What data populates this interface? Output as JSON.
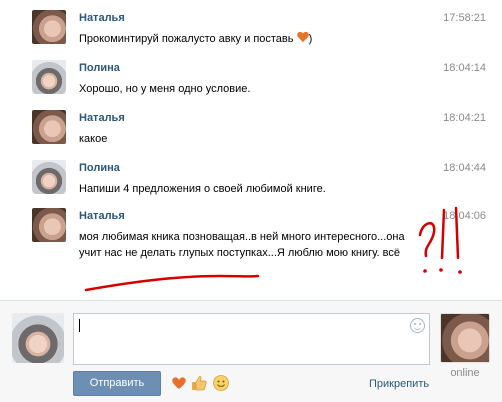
{
  "messages": [
    {
      "author": "Наталья",
      "time": "17:58:21",
      "text": "Прокоминтируй пожалусто авку и поставь",
      "suffix": ")",
      "emoji": "heart-icon",
      "avatar": "natalia"
    },
    {
      "author": "Полина",
      "time": "18:04:14",
      "text": "Хорошо, но у меня одно условие.",
      "avatar": "polina"
    },
    {
      "author": "Наталья",
      "time": "18:04:21",
      "text": "какое",
      "avatar": "natalia"
    },
    {
      "author": "Полина",
      "time": "18:04:44",
      "text": "Напиши 4 предложения о своей любимой книге.",
      "avatar": "polina"
    },
    {
      "author": "Наталья",
      "time": "18:04:06",
      "text": "моя любимая кника позноващая..в ней много интересного...она учит нас не делать глупых поступках...Я люблю мою книгу. всё",
      "avatar": "natalia"
    }
  ],
  "composer": {
    "input_value": "",
    "send_label": "Отправить",
    "attach_label": "Прикрепить",
    "status": "online",
    "emoji_buttons": [
      "heart-icon",
      "thumbs-up-icon",
      "smile-icon"
    ]
  },
  "annotations": {
    "marks": "?!!",
    "color": "#d40000"
  },
  "colors": {
    "author_name": "#2b587a",
    "timestamp": "#8a8a8a",
    "send_button": "#6d8fb3",
    "link": "#2b587a",
    "emoji_heart": "#e8712a"
  }
}
